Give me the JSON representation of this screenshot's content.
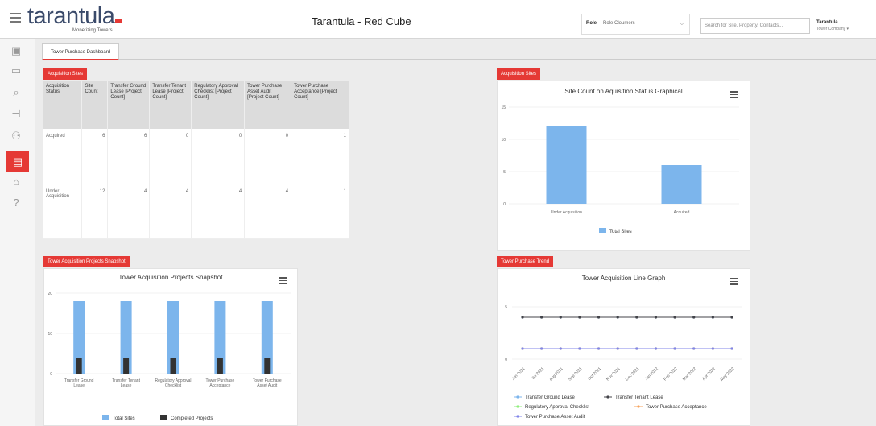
{
  "header": {
    "logo_text": "tarantula",
    "logo_tagline": "Monetizing Towers",
    "app_title": "Tarantula - Red Cube",
    "role_label": "Role",
    "role_value": "Role Cloumers",
    "search_placeholder": "Search for Site, Property, Contacts...",
    "user_name": "Tarantula",
    "user_company": "Tower Company ▾"
  },
  "sidebar": {
    "items": [
      {
        "icon": "excel-icon",
        "glyph": "▣"
      },
      {
        "icon": "document-icon",
        "glyph": "▭"
      },
      {
        "icon": "search-icon",
        "glyph": "⌕"
      },
      {
        "icon": "sitemap-icon",
        "glyph": "⊣"
      },
      {
        "icon": "users-icon",
        "glyph": "⚇"
      },
      {
        "icon": "report-icon",
        "glyph": "▤"
      },
      {
        "icon": "building-icon",
        "glyph": "⌂"
      },
      {
        "icon": "help-icon",
        "glyph": "?"
      }
    ],
    "active_index": 5
  },
  "tabs": [
    "Tower Purchase Dashboard"
  ],
  "acquisition_sites_table": {
    "tag": "Acquisition Sites",
    "headers": [
      "Acquisition Status",
      "Site Count",
      "Transfer Ground Lease [Project Count]",
      "Transfer Tenant Lease [Project Count]",
      "Regulatory Approval Checklist [Project Count]",
      "Tower Purchase Asset Audit [Project Count]",
      "Tower Purchase Acceptance [Project Count]"
    ],
    "rows": [
      [
        "Acquired",
        "6",
        "6",
        "0",
        "0",
        "0",
        "1"
      ],
      [
        "Under Acquisition",
        "12",
        "4",
        "4",
        "4",
        "4",
        "1"
      ]
    ]
  },
  "site_count_panel": {
    "tag": "Acquisition Sites",
    "chart_data": {
      "type": "bar",
      "title": "Site Count on Aquisition Status Graphical",
      "categories": [
        "Under Acquisition",
        "Acquired"
      ],
      "series": [
        {
          "name": "Total Sites",
          "values": [
            12,
            6
          ]
        }
      ],
      "yticks": [
        "0",
        "5",
        "10",
        "15"
      ],
      "ylim": [
        0,
        15
      ],
      "color": "#7cb5ec",
      "legend": "bottom"
    }
  },
  "snapshot_panel": {
    "tag": "Tower Acquisition Projects Snapshot",
    "chart_data": {
      "type": "bar",
      "title": "Tower Acquisition Projects Snapshot",
      "categories": [
        "Transfer Ground Lease",
        "Transfer Tenant Lease",
        "Regulatory Approval Checklist",
        "Tower Purchase Acceptance",
        "Tower Purchase Asset Audit"
      ],
      "series": [
        {
          "name": "Total Sites",
          "values": [
            18,
            18,
            18,
            18,
            18
          ],
          "color": "#7cb5ec"
        },
        {
          "name": "Completed Projects",
          "values": [
            4,
            4,
            4,
            4,
            4
          ],
          "color": "#333333"
        }
      ],
      "yticks": [
        "0",
        "10",
        "20"
      ],
      "ylim": [
        0,
        20
      ],
      "legend": "bottom"
    }
  },
  "trend_panel": {
    "tag": "Tower Purchase Trend",
    "chart_data": {
      "type": "line",
      "title": "Tower Acquisition Line Graph",
      "categories": [
        "Jun 2021",
        "Jul 2021",
        "Aug 2021",
        "Sep 2021",
        "Oct 2021",
        "Nov 2021",
        "Dec 2021",
        "Jan 2022",
        "Feb 2022",
        "Mar 2022",
        "Apr 2022",
        "May 2022"
      ],
      "series": [
        {
          "name": "Transfer Ground Lease",
          "values": [
            4,
            4,
            4,
            4,
            4,
            4,
            4,
            4,
            4,
            4,
            4,
            4
          ],
          "color": "#7cb5ec"
        },
        {
          "name": "Transfer Tenant Lease",
          "values": [
            4,
            4,
            4,
            4,
            4,
            4,
            4,
            4,
            4,
            4,
            4,
            4
          ],
          "color": "#434348"
        },
        {
          "name": "Regulatory Approval Checklist",
          "values": [
            1,
            1,
            1,
            1,
            1,
            1,
            1,
            1,
            1,
            1,
            1,
            1
          ],
          "color": "#90ed7d"
        },
        {
          "name": "Tower Purchase Acceptance",
          "values": [
            1,
            1,
            1,
            1,
            1,
            1,
            1,
            1,
            1,
            1,
            1,
            1
          ],
          "color": "#f7a35c"
        },
        {
          "name": "Tower Purchase Asset Audit",
          "values": [
            1,
            1,
            1,
            1,
            1,
            1,
            1,
            1,
            1,
            1,
            1,
            1
          ],
          "color": "#8085e9"
        }
      ],
      "yticks": [
        "0",
        "5"
      ],
      "ylim": [
        0,
        6
      ],
      "legend": "bottom"
    }
  }
}
